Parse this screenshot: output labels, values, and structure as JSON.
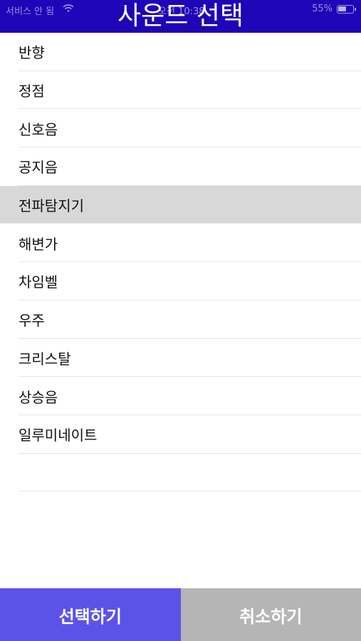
{
  "status_bar": {
    "carrier": "서비스 안 됨",
    "time": "오전 10:38",
    "battery": "55%"
  },
  "header": {
    "title": "사운드 선택"
  },
  "sounds": [
    "반향",
    "정점",
    "신호음",
    "공지음",
    "전파탐지기",
    "해변가",
    "차임벨",
    "우주",
    "크리스탈",
    "상승음",
    "일루미네이트",
    ""
  ],
  "selected_sound": "전파탐지기",
  "footer": {
    "select_label": "선택하기",
    "cancel_label": "취소하기"
  },
  "colors": {
    "header_bg": "#1f04b8",
    "select_button": "#5b52e8",
    "cancel_button": "#b5b5b5",
    "selected_row": "#d8d8d8"
  }
}
